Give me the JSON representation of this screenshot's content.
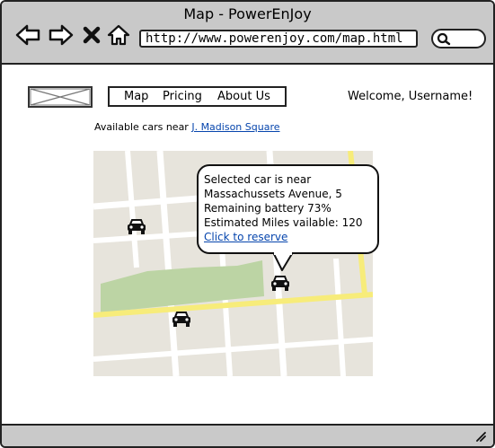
{
  "window": {
    "title": "Map - PowerEnJoy"
  },
  "browser": {
    "url": "http://www.powerenjoy.com/map.html",
    "icons": [
      "back-arrow-icon",
      "forward-arrow-icon",
      "close-icon",
      "home-icon",
      "search-icon"
    ]
  },
  "header": {
    "nav": {
      "map": "Map",
      "pricing": "Pricing",
      "about": "About Us"
    },
    "welcome": "Welcome, Username!"
  },
  "availability": {
    "prefix": "Available cars near",
    "location": "J. Madison Square"
  },
  "map": {
    "colors": {
      "background": "#e7e4dc",
      "streets": "#ffffff",
      "main_road": "#f7ec7a",
      "park": "#bcd4a4"
    }
  },
  "callout": {
    "line1": "Selected car is near",
    "line2": "Massachussets Avenue, 5",
    "line3": "Remaining battery 73%",
    "line4": "Estimated Miles vailable: 120",
    "link": "Click to reserve"
  }
}
